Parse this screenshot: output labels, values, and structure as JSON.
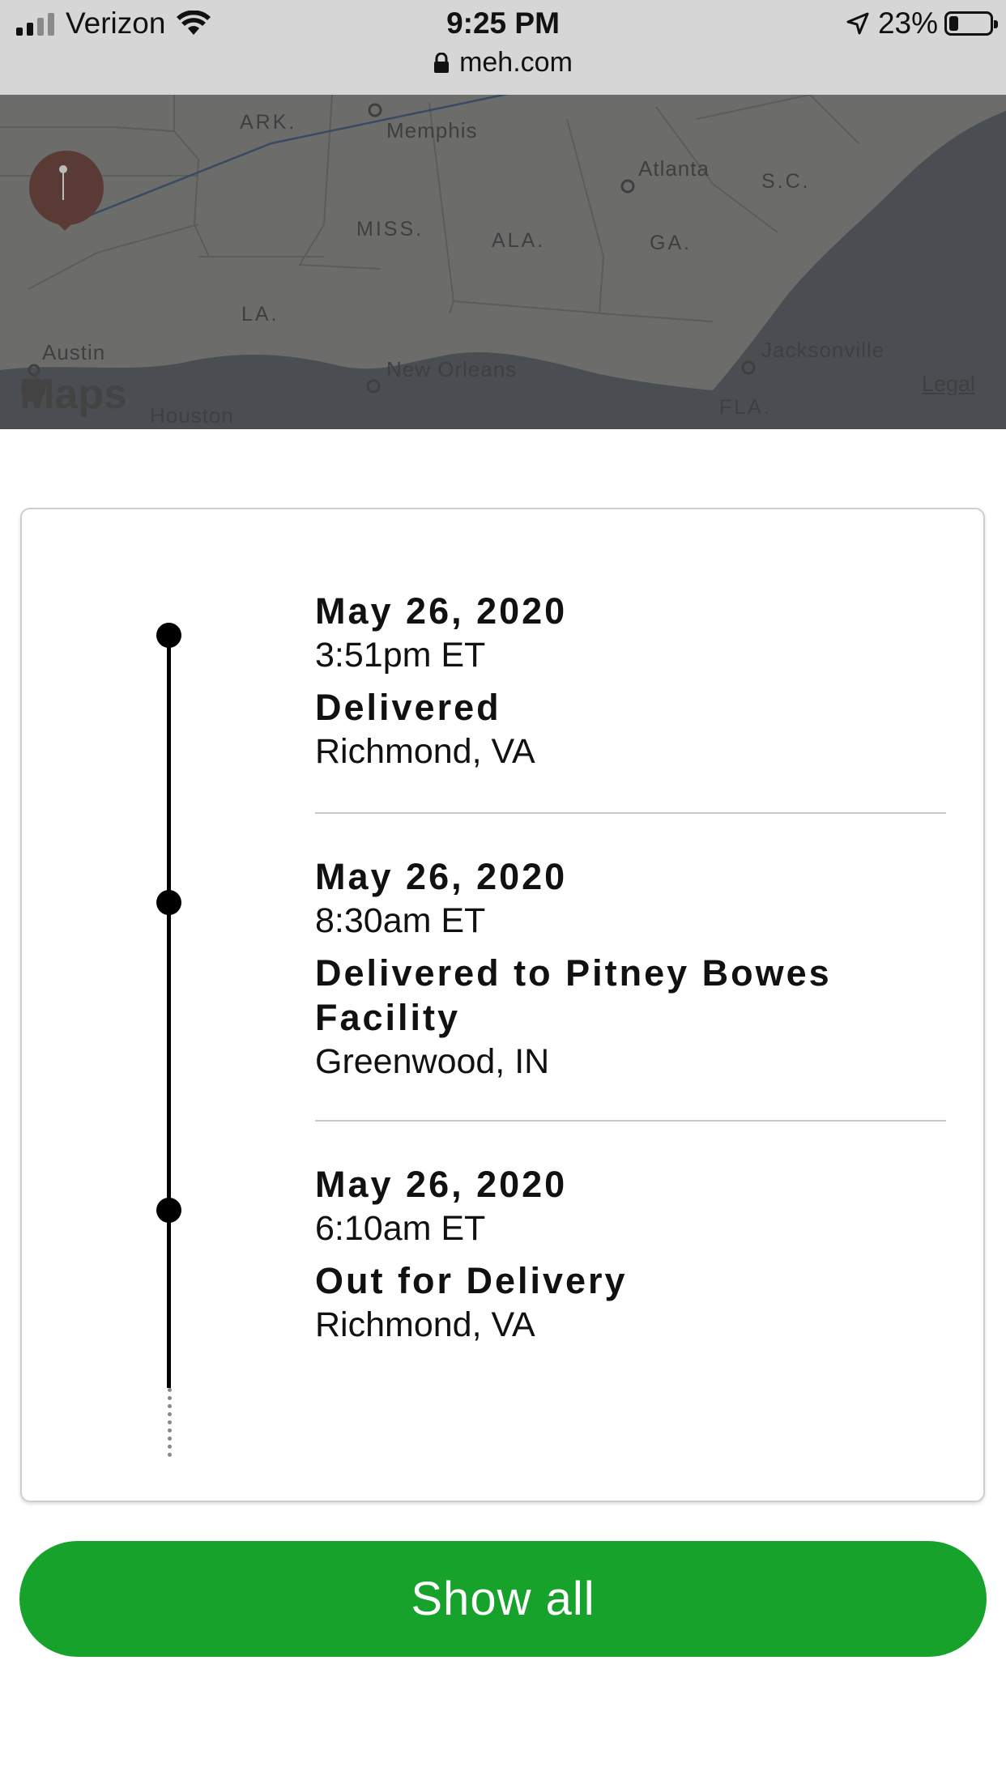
{
  "status_bar": {
    "carrier": "Verizon",
    "time": "9:25 PM",
    "battery_text": "23%",
    "battery_level": 0.23,
    "signal_bars_active": 2,
    "signal_bars_total": 4,
    "icons": [
      "signal-icon",
      "wifi-icon",
      "location-arrow-icon",
      "battery-icon"
    ]
  },
  "url_bar": {
    "url": "meh.com",
    "icon": "lock-icon"
  },
  "map": {
    "states": [
      "ARK.",
      "MISS.",
      "ALA.",
      "GA.",
      "S.C.",
      "LA.",
      "FLA."
    ],
    "cities": [
      "Memphis",
      "Atlanta",
      "Austin",
      "New Orleans",
      "Houston",
      "Jacksonville"
    ],
    "logo_text": "Maps",
    "legal_link": "Legal",
    "colors": {
      "land": "#6c6c6a",
      "water": "#4a4e52",
      "pin": "#5a3a34"
    }
  },
  "tracking": {
    "events": [
      {
        "date": "May 26, 2020",
        "time": "3:51pm ET",
        "status": "Delivered",
        "location": "Richmond, VA"
      },
      {
        "date": "May 26, 2020",
        "time": "8:30am ET",
        "status": "Delivered to Pitney Bowes Facility",
        "location": "Greenwood, IN"
      },
      {
        "date": "May 26, 2020",
        "time": "6:10am ET",
        "status": "Out for Delivery",
        "location": "Richmond, VA"
      }
    ]
  },
  "actions": {
    "show_all_label": "Show all",
    "accent_color": "#16a22b"
  }
}
